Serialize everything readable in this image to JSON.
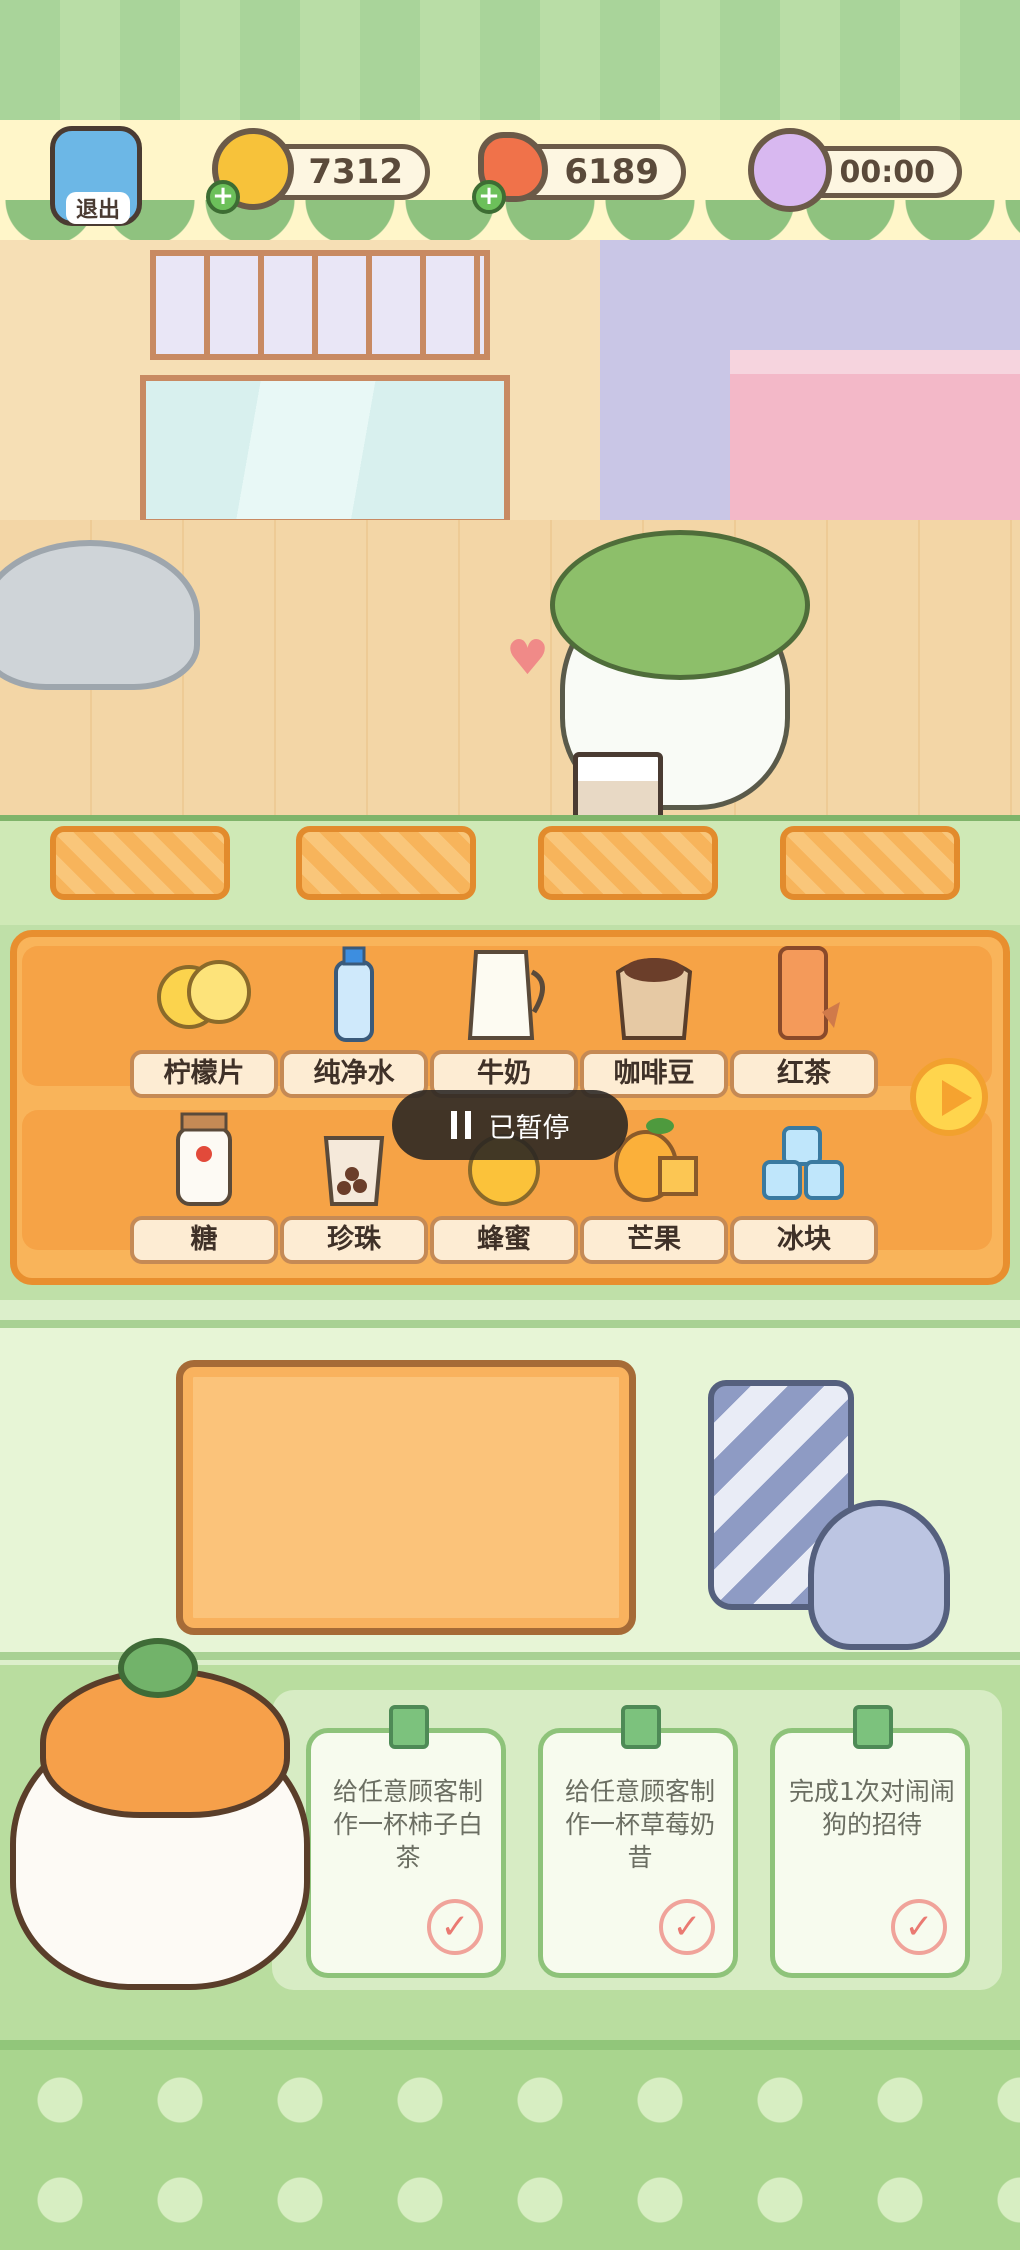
{
  "hud": {
    "exit_label": "退出",
    "coins": "7312",
    "carrots": "6189",
    "timer": "00:00"
  },
  "status": {
    "paused_text": "已暂停"
  },
  "ingredients": {
    "row1": [
      {
        "label": "柠檬片",
        "icon": "lemon-slices-icon"
      },
      {
        "label": "纯净水",
        "icon": "water-bottle-icon"
      },
      {
        "label": "牛奶",
        "icon": "milk-jug-icon"
      },
      {
        "label": "咖啡豆",
        "icon": "coffee-bean-sack-icon"
      },
      {
        "label": "红茶",
        "icon": "black-tea-glass-icon"
      }
    ],
    "row2": [
      {
        "label": "糖",
        "icon": "sugar-jar-icon"
      },
      {
        "label": "珍珠",
        "icon": "boba-pearls-icon"
      },
      {
        "label": "蜂蜜",
        "icon": "honey-jar-icon"
      },
      {
        "label": "芒果",
        "icon": "mango-icon"
      },
      {
        "label": "冰块",
        "icon": "ice-cubes-icon"
      }
    ]
  },
  "tasks": [
    {
      "text": "给任意顾客制作一杯柿子白茶"
    },
    {
      "text": "给任意顾客制作一杯草莓奶昔"
    },
    {
      "text": "完成1次对闹闹狗的招待"
    }
  ],
  "colors": {
    "accent_orange": "#f9b45a",
    "panel_green": "#bfe0a8",
    "label_text": "#3f3128"
  }
}
